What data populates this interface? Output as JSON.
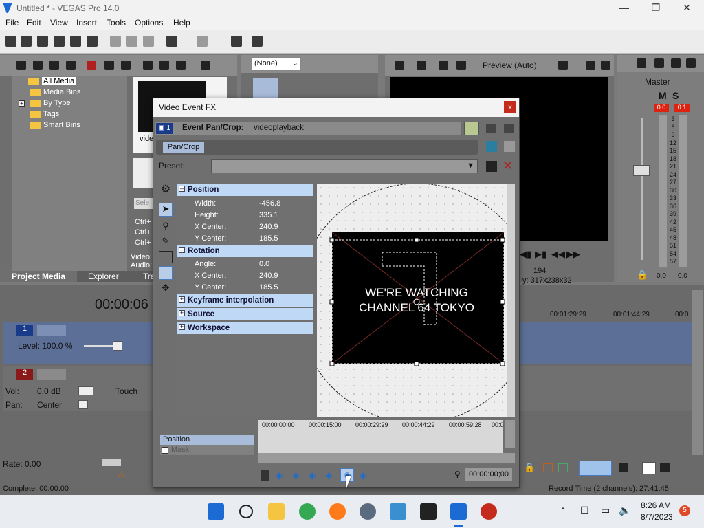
{
  "window": {
    "title": "Untitled * - VEGAS Pro 14.0"
  },
  "menu": [
    "File",
    "Edit",
    "View",
    "Insert",
    "Tools",
    "Options",
    "Help"
  ],
  "project_media": {
    "tree": [
      "All Media",
      "Media Bins",
      "By Type",
      "Tags",
      "Smart Bins"
    ],
    "thumb_label": "vide",
    "shortcuts": [
      "Ctrl+",
      "Ctrl+",
      "Ctrl+"
    ],
    "info": [
      "Video:",
      "Audio:"
    ],
    "tabs": [
      "Project Media",
      "Explorer",
      "Tra"
    ],
    "search_placeholder": "Sele"
  },
  "trimmer": {
    "dropdown": "(None)"
  },
  "preview": {
    "mode": "Preview (Auto)",
    "frame_num": "194",
    "display_prefix": "y:",
    "display": "317x238x32"
  },
  "master": {
    "label": "Master",
    "peak_left": "0.0",
    "peak_right": "0.1",
    "scale": [
      "3",
      "6",
      "9",
      "12",
      "15",
      "18",
      "21",
      "24",
      "27",
      "30",
      "33",
      "36",
      "39",
      "42",
      "45",
      "48",
      "51",
      "54",
      "57"
    ],
    "foot_left": "0.0",
    "foot_right": "0.0"
  },
  "timeline": {
    "timecode": "00:00:06",
    "ruler": [
      "00:01:29:29",
      "00:01:44:29",
      "00:0"
    ],
    "track1": {
      "num": "1",
      "level": "Level: 100.0 %"
    },
    "track2": {
      "num": "2",
      "vol_label": "Vol:",
      "vol": "0.0 dB",
      "pan_label": "Pan:",
      "pan": "Center",
      "touch": "Touch"
    },
    "rate": "Rate: 0.00",
    "complete": "Complete: 00:00:00",
    "record_time": "Record Time (2 channels): 27:41:45"
  },
  "fx_dialog": {
    "title": "Video Event FX",
    "close": "x",
    "event_label": "Event Pan/Crop:",
    "event_name": "videoplayback",
    "chain_item": "Pan/Crop",
    "preset_label": "Preset:",
    "sections": {
      "position": {
        "label": "Position",
        "rows": [
          {
            "name": "Width:",
            "value": "-456.8"
          },
          {
            "name": "Height:",
            "value": "335.1"
          },
          {
            "name": "X Center:",
            "value": "240.9"
          },
          {
            "name": "Y Center:",
            "value": "185.5"
          }
        ]
      },
      "rotation": {
        "label": "Rotation",
        "rows": [
          {
            "name": "Angle:",
            "value": "0.0"
          },
          {
            "name": "X Center:",
            "value": "240.9"
          },
          {
            "name": "Y Center:",
            "value": "185.5"
          }
        ]
      },
      "keyframe": {
        "label": "Keyframe interpolation"
      },
      "source": {
        "label": "Source"
      },
      "workspace": {
        "label": "Workspace"
      }
    },
    "canvas_text": [
      "WE'RE WATCHING",
      "CHANNEL 64 TOKYO"
    ],
    "keyframe_tracks": [
      "Position",
      "Mask"
    ],
    "kf_ruler": [
      "00:00:00:00",
      "00:00:15:00",
      "00:00:29:29",
      "00:00:44:29",
      "00:00:59:28",
      "00:0"
    ],
    "kf_time": "00:00:00;00"
  },
  "taskbar": {
    "time": "8:26 AM",
    "date": "8/7/2023",
    "badge": "5"
  },
  "colors": {
    "accent": "#1c6bd4",
    "section": "#bfd8f5",
    "track1": "#5c6f96",
    "record": "#c42b1c"
  }
}
